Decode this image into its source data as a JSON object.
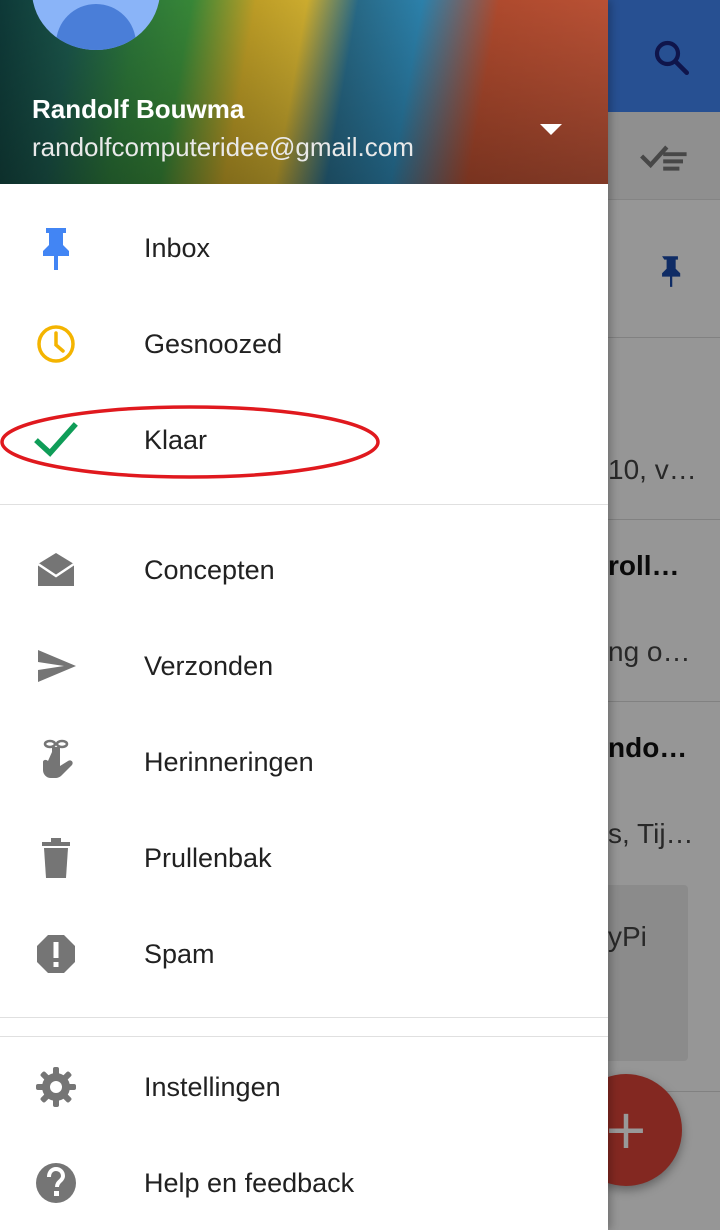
{
  "background": {
    "snippets": [
      "10, v…",
      "roll…",
      "ng o…",
      "ndo…",
      "s, Tij…",
      "yPi"
    ],
    "fab_label": "+"
  },
  "account": {
    "name": "Randolf Bouwma",
    "email": "randolfcomputeridee@gmail.com"
  },
  "nav": {
    "primary": [
      {
        "label": "Inbox",
        "icon": "pin-icon",
        "color": "#4285f4"
      },
      {
        "label": "Gesnoozed",
        "icon": "clock-icon",
        "color": "#f4b400"
      },
      {
        "label": "Klaar",
        "icon": "checkmark-icon",
        "color": "#0f9d58"
      }
    ],
    "secondary": [
      {
        "label": "Concepten",
        "icon": "drafts-icon"
      },
      {
        "label": "Verzonden",
        "icon": "send-icon"
      },
      {
        "label": "Herinneringen",
        "icon": "reminder-icon"
      },
      {
        "label": "Prullenbak",
        "icon": "trash-icon"
      },
      {
        "label": "Spam",
        "icon": "spam-icon"
      }
    ],
    "footer": [
      {
        "label": "Instellingen",
        "icon": "gear-icon"
      },
      {
        "label": "Help en feedback",
        "icon": "help-icon"
      }
    ]
  },
  "annotation": {
    "highlight_color": "#e0191e"
  },
  "colors": {
    "appbar": "#4285f4",
    "fab": "#db4437",
    "icon_gray": "#757575"
  }
}
